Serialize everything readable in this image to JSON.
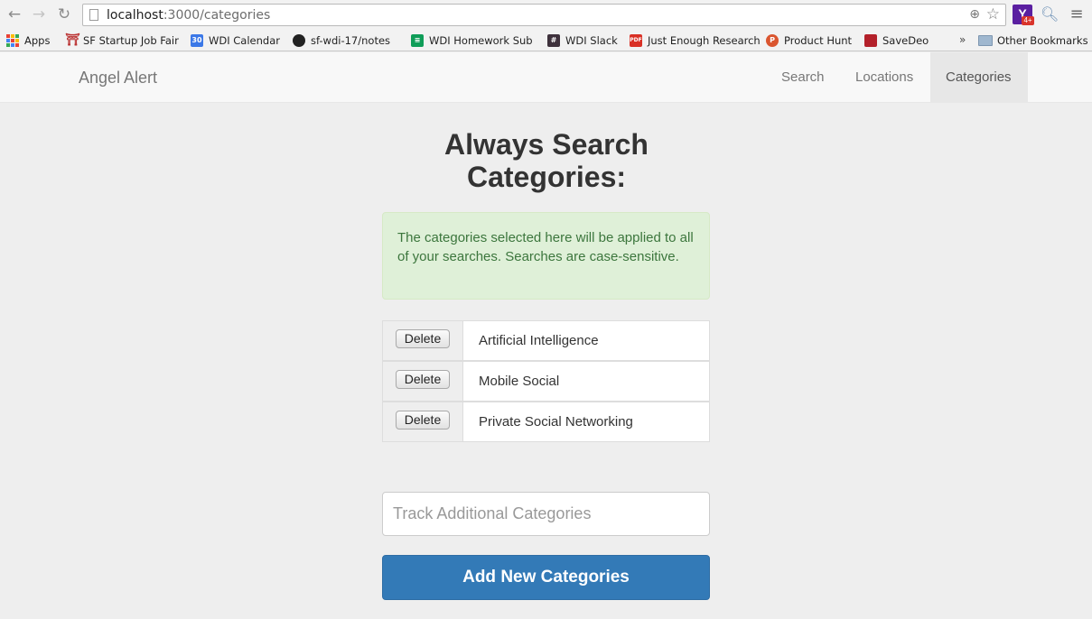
{
  "browser": {
    "url_host": "localhost",
    "url_path": ":3000/categories",
    "icons": {
      "back": "back-arrow-icon",
      "forward": "forward-arrow-icon",
      "reload": "reload-icon",
      "zoom": "zoom-icon",
      "star": "bookmark-star-icon",
      "menu": "menu-icon"
    },
    "extension_badge": "4+",
    "extension_letter": "Y"
  },
  "bookmarks": {
    "items": [
      {
        "label": "Apps",
        "icon": "apps-grid-icon"
      },
      {
        "label": "SF Startup Job Fair",
        "icon": "bridge-icon"
      },
      {
        "label": "WDI Calendar",
        "icon": "calendar-icon",
        "icon_text": "30"
      },
      {
        "label": "sf-wdi-17/notes",
        "icon": "github-icon"
      },
      {
        "label": "WDI Homework Subr",
        "icon": "sheets-icon"
      },
      {
        "label": "WDI Slack",
        "icon": "slack-icon",
        "icon_text": "#"
      },
      {
        "label": "Just Enough Research",
        "icon": "pdf-icon",
        "icon_text": "PDF"
      },
      {
        "label": "Product Hunt",
        "icon": "product-hunt-icon",
        "icon_text": "P"
      },
      {
        "label": "SaveDeo",
        "icon": "savedeo-icon"
      }
    ],
    "overflow": "»",
    "other": "Other Bookmarks"
  },
  "navbar": {
    "brand": "Angel Alert",
    "links": [
      {
        "label": "Search",
        "active": false
      },
      {
        "label": "Locations",
        "active": false
      },
      {
        "label": "Categories",
        "active": true
      }
    ]
  },
  "main": {
    "title_line1": "Always Search",
    "title_line2": "Categories:",
    "alert": "The categories selected here will be applied to all of your searches. Searches are case-sensitive.",
    "delete_label": "Delete",
    "categories": [
      "Artificial Intelligence",
      "Mobile Social",
      "Private Social Networking"
    ],
    "input_placeholder": "Track Additional Categories",
    "add_button": "Add New Categories"
  },
  "colors": {
    "primary": "#337ab7",
    "alert_bg": "#dff0d8",
    "alert_text": "#3c763d"
  }
}
